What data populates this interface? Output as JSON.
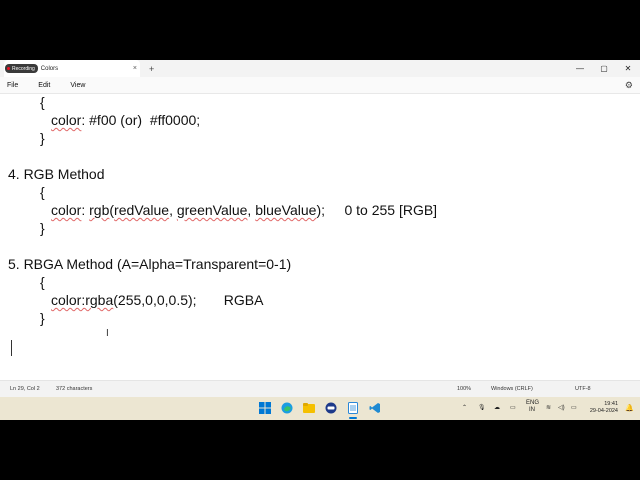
{
  "window": {
    "recording_label": "Recording",
    "tab_title": "Colors",
    "tab_close": "×",
    "new_tab": "+",
    "minimize": "—",
    "maximize": "▢",
    "close": "✕"
  },
  "menu": {
    "file": "File",
    "edit": "Edit",
    "view": "View",
    "settings_icon": "⚙"
  },
  "editor": {
    "l1": "{",
    "l2_a": "color",
    "l2_b": ": #f00 (or)  #ff0000;",
    "l3": "}",
    "l4": "4. RGB Method",
    "l5": "{",
    "l6_a": "color",
    "l6_b": ": ",
    "l6_c": "rgb",
    "l6_d": "(",
    "l6_e": "redValue",
    "l6_f": ", ",
    "l6_g": "greenValue",
    "l6_h": ", ",
    "l6_i": "blueValue",
    "l6_j": ");     0 to 255 [RGB]",
    "l7": "}",
    "l8": "5. RBGA Method (A=Alpha=Transparent=0-1)",
    "l9": "{",
    "l10_a": "color:rgba",
    "l10_b": "(255,0,0,0.5);       RGBA",
    "l11": "}"
  },
  "status": {
    "position": "Ln 29, Col 2",
    "characters": "372 characters",
    "zoom": "100%",
    "line_ending": "Windows (CRLF)",
    "encoding": "UTF-8"
  },
  "taskbar": {
    "lang_top": "ENG",
    "lang_bottom": "IN",
    "time": "19:41",
    "date": "29-04-2024",
    "accent": "#0078d4"
  }
}
